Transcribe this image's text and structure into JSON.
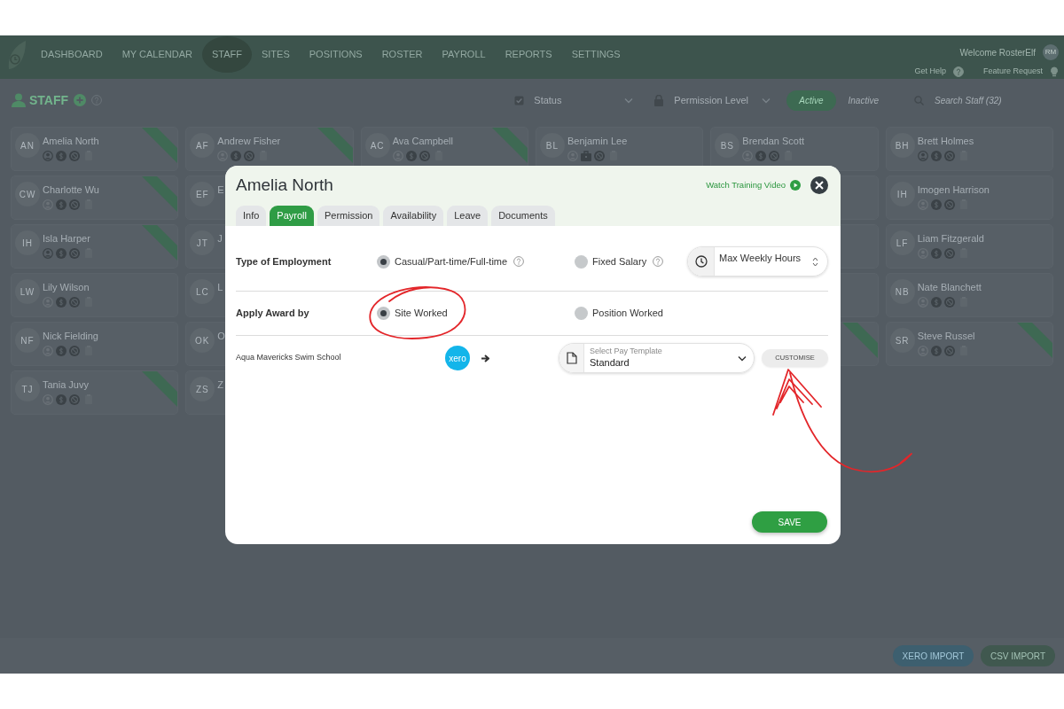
{
  "navbar": {
    "items": [
      {
        "label": "DASHBOARD",
        "selected": false
      },
      {
        "label": "MY CALENDAR",
        "selected": false
      },
      {
        "label": "STAFF",
        "selected": true
      },
      {
        "label": "SITES",
        "selected": false
      },
      {
        "label": "POSITIONS",
        "selected": false
      },
      {
        "label": "ROSTER",
        "selected": false
      },
      {
        "label": "PAYROLL",
        "selected": false
      },
      {
        "label": "REPORTS",
        "selected": false
      },
      {
        "label": "SETTINGS",
        "selected": false
      }
    ],
    "welcome": "Welcome RosterElf",
    "avatar_initials": "RM",
    "links": [
      {
        "label": "Get Help",
        "kind": "help"
      },
      {
        "label": "Feature Request",
        "kind": "idea"
      }
    ]
  },
  "staff_header": {
    "title": "STAFF",
    "filters": [
      {
        "label": "Status",
        "kind": "status"
      },
      {
        "label": "Permission Level",
        "kind": "permission"
      }
    ],
    "toggle": [
      {
        "label": "Active",
        "selected": true
      },
      {
        "label": "Inactive",
        "selected": false
      }
    ],
    "search": {
      "placeholder": "Search Staff (32)"
    }
  },
  "staff_columns": [
    [
      {
        "initials": "AN",
        "name": "Amelia North",
        "person_active": true,
        "salaried": false,
        "ribbon": true
      },
      {
        "initials": "CW",
        "name": "Charlotte Wu",
        "person_active": false,
        "salaried": false,
        "ribbon": true
      },
      {
        "initials": "IH",
        "name": "Isla Harper",
        "person_active": true,
        "salaried": false,
        "ribbon": true
      },
      {
        "initials": "LW",
        "name": "Lily Wilson",
        "person_active": false,
        "salaried": false,
        "ribbon": false
      },
      {
        "initials": "NF",
        "name": "Nick Fielding",
        "person_active": false,
        "salaried": false,
        "ribbon": false
      },
      {
        "initials": "TJ",
        "name": "Tania Juvy",
        "person_active": false,
        "salaried": false,
        "ribbon": true
      }
    ],
    [
      {
        "initials": "AF",
        "name": "Andrew Fisher",
        "person_active": false,
        "salaried": false,
        "ribbon": true
      },
      {
        "initials": "EF",
        "name": "E"
      },
      {
        "initials": "JT",
        "name": "J"
      },
      {
        "initials": "LC",
        "name": "L"
      },
      {
        "initials": "OK",
        "name": "O"
      },
      {
        "initials": "ZS",
        "name": "Z"
      }
    ],
    [
      {
        "initials": "AC",
        "name": "Ava Campbell",
        "person_active": false,
        "salaried": false,
        "ribbon": true
      }
    ],
    [
      {
        "initials": "BL",
        "name": "Benjamin Lee",
        "person_active": false,
        "salaried": true,
        "ribbon": false
      }
    ],
    [
      {
        "initials": "BS",
        "name": "Brendan Scott",
        "person_active": false,
        "salaried": false,
        "ribbon": false
      },
      {
        "ribbon": false
      },
      {
        "ribbon": false
      },
      {
        "ribbon": false
      },
      {
        "ribbon": true
      }
    ],
    [
      {
        "initials": "BH",
        "name": "Brett Holmes",
        "person_active": true,
        "salaried": false,
        "ribbon": false
      },
      {
        "initials": "IH",
        "name": "Imogen Harrison",
        "person_active": false,
        "salaried": false,
        "ribbon": false
      },
      {
        "initials": "LF",
        "name": "Liam Fitzgerald",
        "person_active": false,
        "salaried": false,
        "ribbon": false
      },
      {
        "initials": "NB",
        "name": "Nate Blanchett",
        "person_active": false,
        "salaried": false,
        "ribbon": false
      },
      {
        "initials": "SR",
        "name": "Steve Russel",
        "person_active": false,
        "salaried": false,
        "ribbon": true
      }
    ]
  ],
  "footer_buttons": [
    {
      "label": "XERO IMPORT",
      "kind": "xero"
    },
    {
      "label": "CSV IMPORT",
      "kind": "csv"
    }
  ],
  "dialog": {
    "title": "Amelia North",
    "training_link": "Watch Training Video",
    "tabs": [
      {
        "label": "Info",
        "selected": false
      },
      {
        "label": "Payroll",
        "selected": true
      },
      {
        "label": "Permission",
        "selected": false
      },
      {
        "label": "Availability",
        "selected": false
      },
      {
        "label": "Leave",
        "selected": false
      },
      {
        "label": "Documents",
        "selected": false
      }
    ],
    "employment": {
      "label": "Type of Employment",
      "options": [
        {
          "label": "Casual/Part-time/Full-time",
          "selected": true,
          "help": true
        },
        {
          "label": "Fixed Salary",
          "selected": false,
          "help": true
        }
      ],
      "max_hours": {
        "placeholder": "Max Weekly Hours"
      }
    },
    "award": {
      "label": "Apply Award by",
      "options": [
        {
          "label": "Site Worked",
          "selected": true
        },
        {
          "label": "Position Worked",
          "selected": false
        }
      ]
    },
    "sites": [
      {
        "name": "Aqua Mavericks Swim School",
        "logo_text": "xero",
        "template": {
          "label": "Select Pay Template",
          "value": "Standard"
        },
        "action": "CUSTOMISE"
      }
    ],
    "save": "SAVE"
  }
}
